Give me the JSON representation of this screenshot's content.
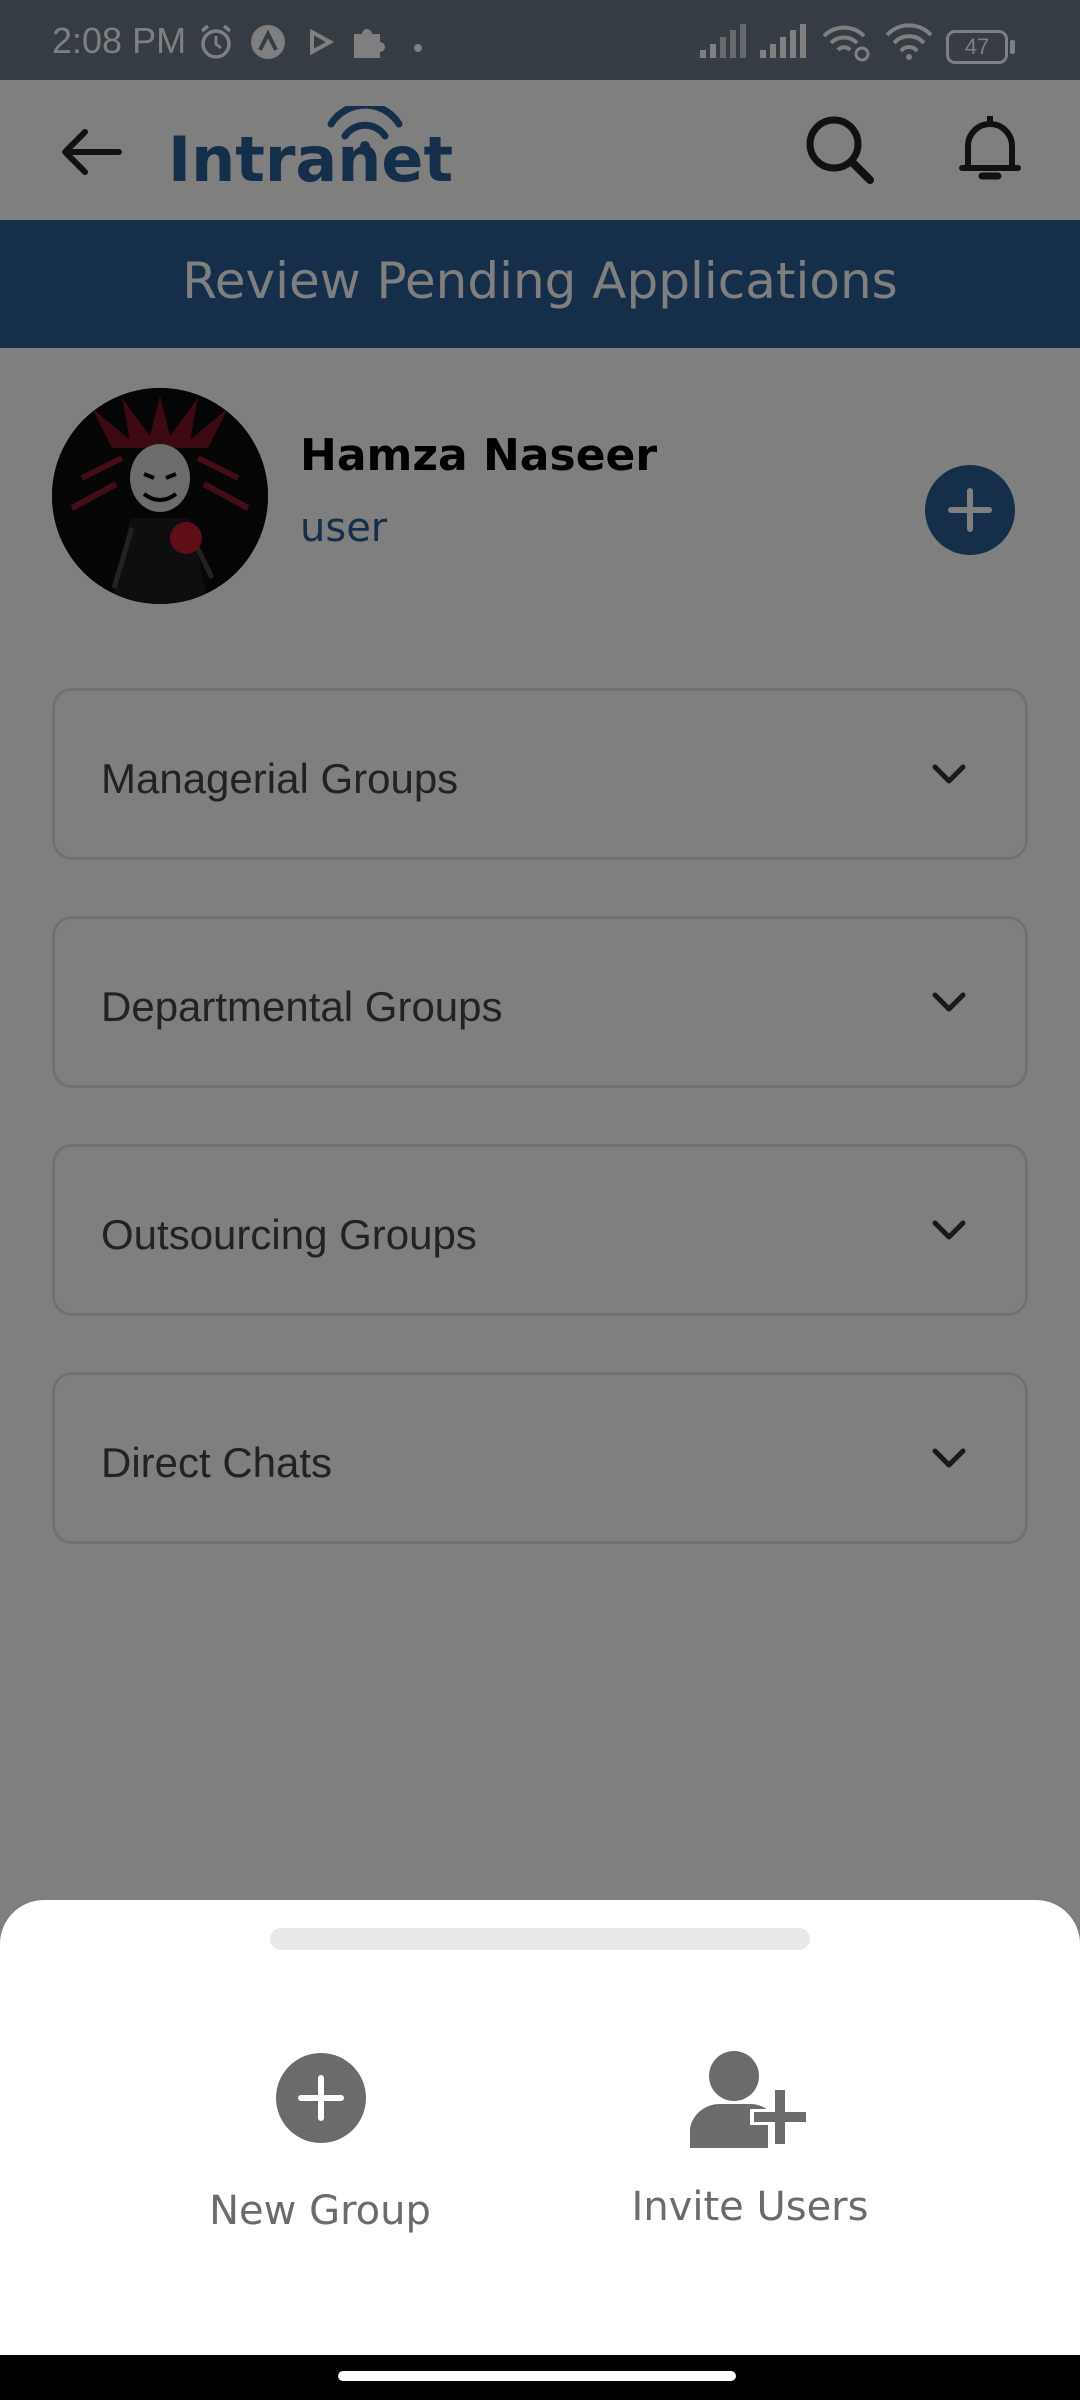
{
  "status_bar": {
    "time": "2:08 PM",
    "battery": "47",
    "icons": [
      "alarm-icon",
      "app-icon",
      "play-icon",
      "puzzle-icon",
      "dot-icon",
      "signal-icon",
      "signal-icon",
      "wifi-link-icon",
      "wifi-icon",
      "battery-icon"
    ]
  },
  "app_bar": {
    "logo": "Intranet",
    "icons": [
      "back-arrow-icon",
      "wifi-logo-icon",
      "search-icon",
      "bell-icon"
    ]
  },
  "banner": {
    "title": "Review Pending Applications"
  },
  "profile": {
    "name": "Hamza Naseer",
    "role": "user"
  },
  "groups": [
    {
      "label": "Managerial Groups"
    },
    {
      "label": "Departmental Groups"
    },
    {
      "label": "Outsourcing Groups"
    },
    {
      "label": "Direct Chats"
    }
  ],
  "bottom_sheet": {
    "actions": [
      {
        "label": "New Group",
        "icon": "plus-circle-icon"
      },
      {
        "label": "Invite Users",
        "icon": "add-user-icon"
      }
    ]
  },
  "colors": {
    "primary": "#2a5d95",
    "scrim": "rgba(0,0,0,0.5)",
    "status_bar": "#6b7987",
    "sheet_icon": "#6b6b6b"
  }
}
